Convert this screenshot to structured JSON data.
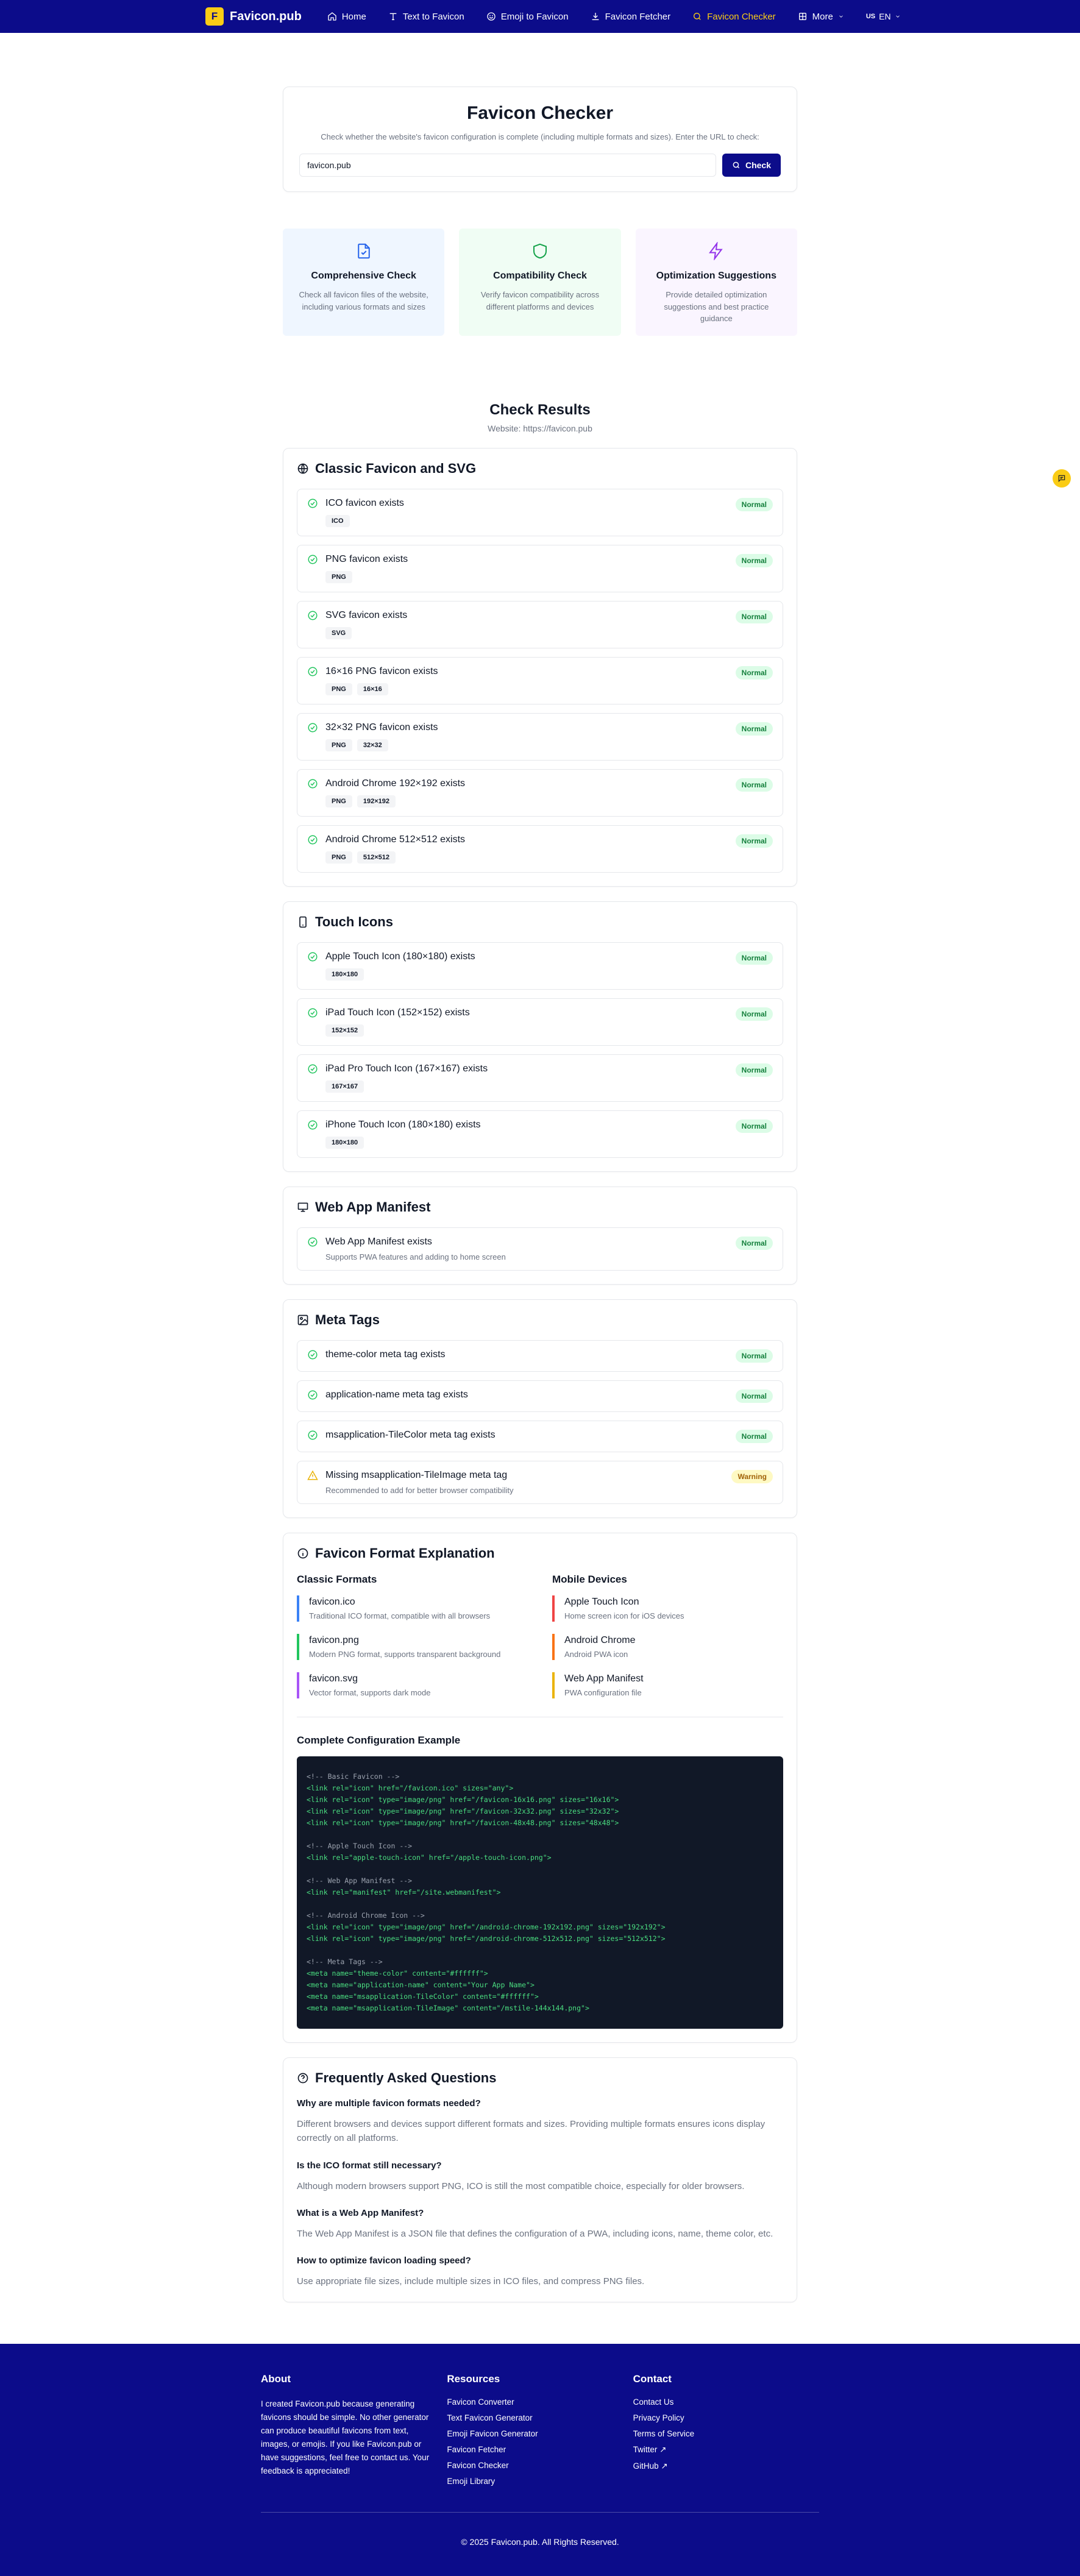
{
  "nav": {
    "brand_initial": "F",
    "brand_name": "Favicon.pub",
    "items": [
      {
        "label": "Home"
      },
      {
        "label": "Text to Favicon"
      },
      {
        "label": "Emoji to Favicon"
      },
      {
        "label": "Favicon Fetcher"
      },
      {
        "label": "Favicon Checker"
      },
      {
        "label": "More"
      }
    ],
    "lang_flag": "US",
    "lang_label": "EN"
  },
  "hero": {
    "title": "Favicon Checker",
    "description": "Check whether the website's favicon configuration is complete (including multiple formats and sizes). Enter the URL to check:",
    "input_value": "favicon.pub",
    "button_label": "Check"
  },
  "features": [
    {
      "title": "Comprehensive Check",
      "desc": "Check all favicon files of the website, including various formats and sizes"
    },
    {
      "title": "Compatibility Check",
      "desc": "Verify favicon compatibility across different platforms and devices"
    },
    {
      "title": "Optimization Suggestions",
      "desc": "Provide detailed optimization suggestions and best practice guidance"
    }
  ],
  "results": {
    "title": "Check Results",
    "website": "Website: https://favicon.pub"
  },
  "classic": {
    "title": "Classic Favicon and SVG",
    "items": [
      {
        "title": "ICO favicon exists",
        "tags": [
          "ICO"
        ],
        "status": "Normal"
      },
      {
        "title": "PNG favicon exists",
        "tags": [
          "PNG"
        ],
        "status": "Normal"
      },
      {
        "title": "SVG favicon exists",
        "tags": [
          "SVG"
        ],
        "status": "Normal"
      },
      {
        "title": "16×16 PNG favicon exists",
        "tags": [
          "PNG",
          "16×16"
        ],
        "status": "Normal"
      },
      {
        "title": "32×32 PNG favicon exists",
        "tags": [
          "PNG",
          "32×32"
        ],
        "status": "Normal"
      },
      {
        "title": "Android Chrome 192×192 exists",
        "tags": [
          "PNG",
          "192×192"
        ],
        "status": "Normal"
      },
      {
        "title": "Android Chrome 512×512 exists",
        "tags": [
          "PNG",
          "512×512"
        ],
        "status": "Normal"
      }
    ]
  },
  "touch": {
    "title": "Touch Icons",
    "items": [
      {
        "title": "Apple Touch Icon (180×180) exists",
        "tags": [
          "180×180"
        ],
        "status": "Normal"
      },
      {
        "title": "iPad Touch Icon (152×152) exists",
        "tags": [
          "152×152"
        ],
        "status": "Normal"
      },
      {
        "title": "iPad Pro Touch Icon (167×167) exists",
        "tags": [
          "167×167"
        ],
        "status": "Normal"
      },
      {
        "title": "iPhone Touch Icon (180×180) exists",
        "tags": [
          "180×180"
        ],
        "status": "Normal"
      }
    ]
  },
  "manifest": {
    "title": "Web App Manifest",
    "item_title": "Web App Manifest exists",
    "item_desc": "Supports PWA features and adding to home screen",
    "status": "Normal"
  },
  "meta": {
    "title": "Meta Tags",
    "items": [
      {
        "title": "theme-color meta tag exists",
        "status": "Normal"
      },
      {
        "title": "application-name meta tag exists",
        "status": "Normal"
      },
      {
        "title": "msapplication-TileColor meta tag exists",
        "status": "Normal"
      }
    ],
    "warning_title": "Missing msapplication-TileImage meta tag",
    "warning_desc": "Recommended to add for better browser compatibility",
    "warning_status": "Warning"
  },
  "format": {
    "title": "Favicon Format Explanation",
    "classic_heading": "Classic Formats",
    "mobile_heading": "Mobile Devices",
    "classic": [
      {
        "name": "favicon.ico",
        "desc": "Traditional ICO format, compatible with all browsers",
        "color": "#3b82f6"
      },
      {
        "name": "favicon.png",
        "desc": "Modern PNG format, supports transparent background",
        "color": "#22c55e"
      },
      {
        "name": "favicon.svg",
        "desc": "Vector format, supports dark mode",
        "color": "#a855f7"
      }
    ],
    "mobile": [
      {
        "name": "Apple Touch Icon",
        "desc": "Home screen icon for iOS devices",
        "color": "#ef4444"
      },
      {
        "name": "Android Chrome",
        "desc": "Android PWA icon",
        "color": "#f97316"
      },
      {
        "name": "Web App Manifest",
        "desc": "PWA configuration file",
        "color": "#eab308"
      }
    ],
    "config_title": "Complete Configuration Example",
    "code_lines": [
      {
        "t": "<!-- Basic Favicon -->",
        "c": true
      },
      {
        "t": "<link rel=\"icon\" href=\"/favicon.ico\" sizes=\"any\">"
      },
      {
        "t": "<link rel=\"icon\" type=\"image/png\" href=\"/favicon-16x16.png\" sizes=\"16x16\">"
      },
      {
        "t": "<link rel=\"icon\" type=\"image/png\" href=\"/favicon-32x32.png\" sizes=\"32x32\">"
      },
      {
        "t": "<link rel=\"icon\" type=\"image/png\" href=\"/favicon-48x48.png\" sizes=\"48x48\">"
      },
      {
        "t": ""
      },
      {
        "t": "<!-- Apple Touch Icon -->",
        "c": true
      },
      {
        "t": "<link rel=\"apple-touch-icon\" href=\"/apple-touch-icon.png\">"
      },
      {
        "t": ""
      },
      {
        "t": "<!-- Web App Manifest -->",
        "c": true
      },
      {
        "t": "<link rel=\"manifest\" href=\"/site.webmanifest\">"
      },
      {
        "t": ""
      },
      {
        "t": "<!-- Android Chrome Icon -->",
        "c": true
      },
      {
        "t": "<link rel=\"icon\" type=\"image/png\" href=\"/android-chrome-192x192.png\" sizes=\"192x192\">"
      },
      {
        "t": "<link rel=\"icon\" type=\"image/png\" href=\"/android-chrome-512x512.png\" sizes=\"512x512\">"
      },
      {
        "t": ""
      },
      {
        "t": "<!-- Meta Tags -->",
        "c": true
      },
      {
        "t": "<meta name=\"theme-color\" content=\"#ffffff\">"
      },
      {
        "t": "<meta name=\"application-name\" content=\"Your App Name\">"
      },
      {
        "t": "<meta name=\"msapplication-TileColor\" content=\"#ffffff\">"
      },
      {
        "t": "<meta name=\"msapplication-TileImage\" content=\"/mstile-144x144.png\">"
      }
    ]
  },
  "faq": {
    "title": "Frequently Asked Questions",
    "items": [
      {
        "q": "Why are multiple favicon formats needed?",
        "a": "Different browsers and devices support different formats and sizes. Providing multiple formats ensures icons display correctly on all platforms."
      },
      {
        "q": "Is the ICO format still necessary?",
        "a": "Although modern browsers support PNG, ICO is still the most compatible choice, especially for older browsers."
      },
      {
        "q": "What is a Web App Manifest?",
        "a": "The Web App Manifest is a JSON file that defines the configuration of a PWA, including icons, name, theme color, etc."
      },
      {
        "q": "How to optimize favicon loading speed?",
        "a": "Use appropriate file sizes, include multiple sizes in ICO files, and compress PNG files."
      }
    ]
  },
  "footer": {
    "about_title": "About",
    "about_text": "I created Favicon.pub because generating favicons should be simple. No other generator can produce beautiful favicons from text, images, or emojis. If you like Favicon.pub or have suggestions, feel free to contact us. Your feedback is appreciated!",
    "resources_title": "Resources",
    "resources": [
      "Favicon Converter",
      "Text Favicon Generator",
      "Emoji Favicon Generator",
      "Favicon Fetcher",
      "Favicon Checker",
      "Emoji Library"
    ],
    "contact_title": "Contact",
    "contact": [
      "Contact Us",
      "Privacy Policy",
      "Terms of Service",
      "Twitter ↗",
      "GitHub ↗"
    ],
    "copyright": "© 2025 Favicon.pub. All Rights Reserved."
  },
  "colors": {
    "brand": "#0c0c8a",
    "accent": "#facc15",
    "success": "#22c55e",
    "warning": "#eab308"
  }
}
